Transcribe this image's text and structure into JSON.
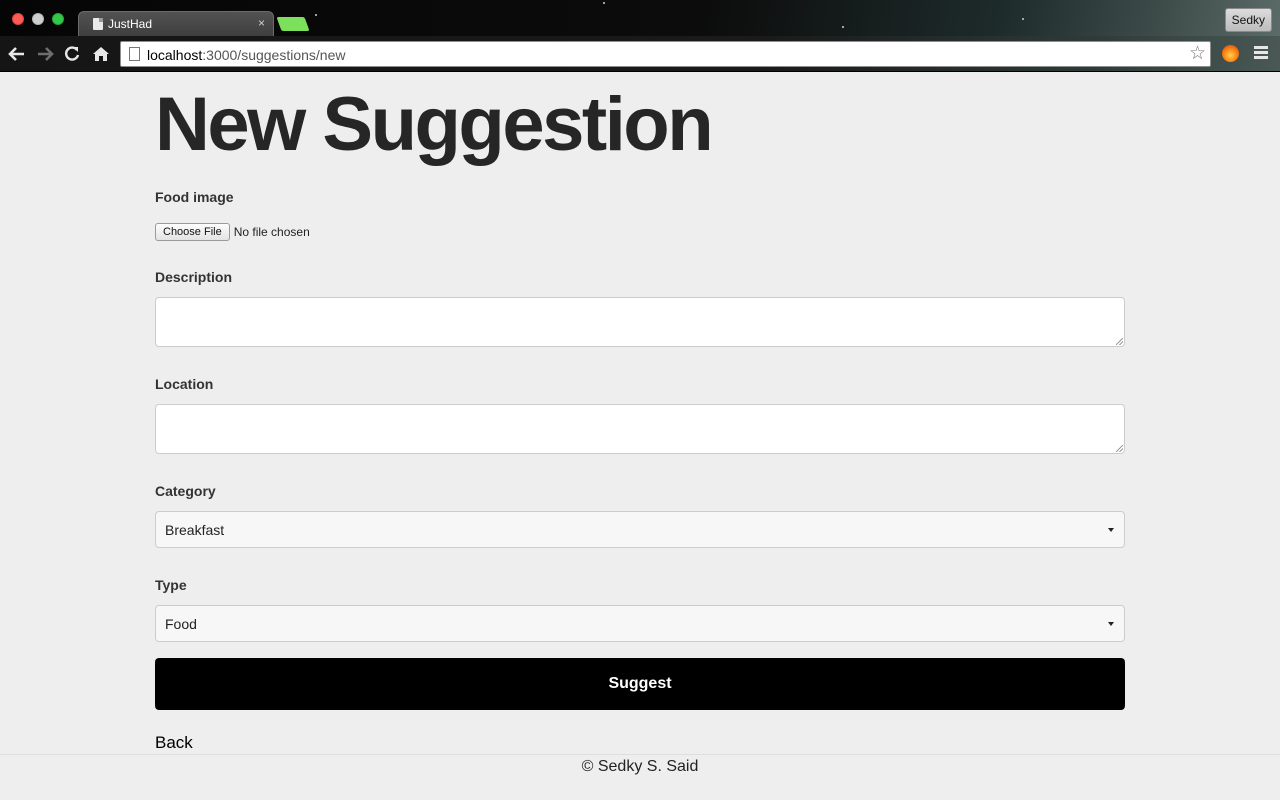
{
  "browser": {
    "tab_title": "JustHad",
    "tab_close_glyph": "×",
    "profile_name": "Sedky",
    "url_host": "localhost",
    "url_rest": ":3000/suggestions/new",
    "icons": {
      "back": "back-arrow-icon",
      "forward": "forward-arrow-icon",
      "reload": "reload-icon",
      "home": "home-icon",
      "bookmark": "star-icon",
      "extension": "extension-icon",
      "menu": "hamburger-menu-icon"
    }
  },
  "page": {
    "title": "New Suggestion",
    "form": {
      "food_image_label": "Food image",
      "choose_file_label": "Choose File",
      "file_status": "No file chosen",
      "description_label": "Description",
      "description_value": "",
      "location_label": "Location",
      "location_value": "",
      "category_label": "Category",
      "category_value": "Breakfast",
      "type_label": "Type",
      "type_value": "Food",
      "submit_label": "Suggest"
    },
    "back_link": "Back",
    "footer": "© Sedky S. Said"
  },
  "colors": {
    "page_background": "#eeeeee",
    "submit_button": "#000000",
    "new_tab_accent": "#7ce05a"
  }
}
